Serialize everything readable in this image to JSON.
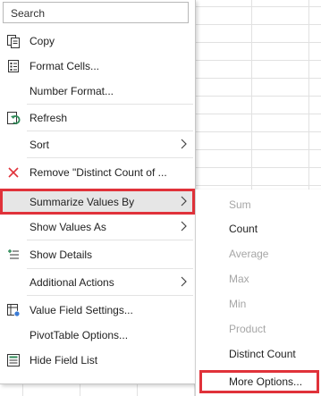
{
  "search": {
    "placeholder": "Search"
  },
  "menu": {
    "items": [
      {
        "label": "Copy"
      },
      {
        "label": "Format Cells..."
      },
      {
        "label": "Number Format..."
      },
      {
        "label": "Refresh"
      },
      {
        "label": "Sort"
      },
      {
        "label": "Remove \"Distinct Count of ..."
      },
      {
        "label": "Summarize Values By"
      },
      {
        "label": "Show Values As"
      },
      {
        "label": "Show Details"
      },
      {
        "label": "Additional Actions"
      },
      {
        "label": "Value Field Settings..."
      },
      {
        "label": "PivotTable Options..."
      },
      {
        "label": "Hide Field List"
      }
    ]
  },
  "submenu": {
    "items": [
      {
        "label": "Sum",
        "enabled": false
      },
      {
        "label": "Count",
        "enabled": true
      },
      {
        "label": "Average",
        "enabled": false
      },
      {
        "label": "Max",
        "enabled": false
      },
      {
        "label": "Min",
        "enabled": false
      },
      {
        "label": "Product",
        "enabled": false
      },
      {
        "label": "Distinct Count",
        "enabled": true
      },
      {
        "label": "More Options...",
        "enabled": true
      }
    ]
  },
  "colors": {
    "highlight_border": "#e0323a",
    "remove_icon": "#e0323a",
    "refresh_icon": "#2e8b57"
  }
}
